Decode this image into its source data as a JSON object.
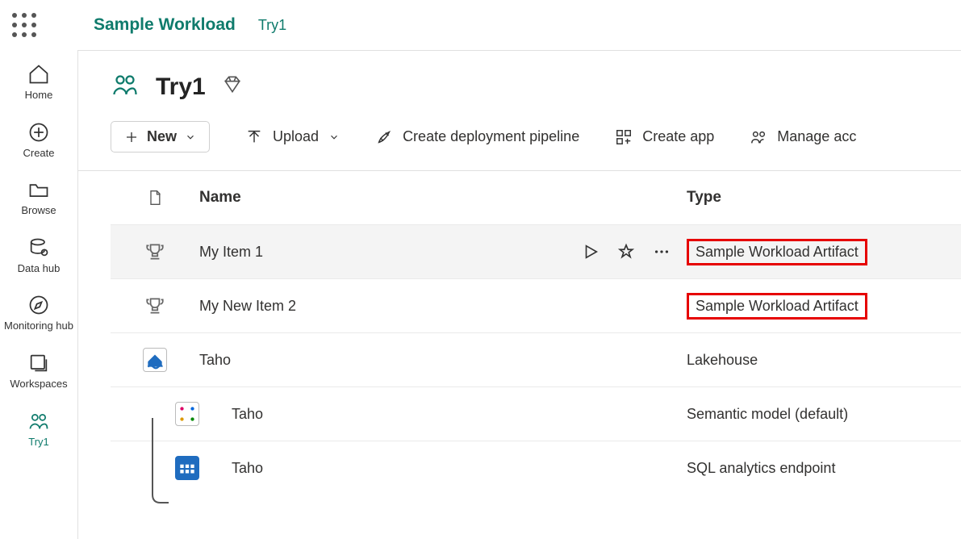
{
  "header": {
    "product": "Sample Workload",
    "workspace": "Try1"
  },
  "nav": {
    "home": "Home",
    "create": "Create",
    "browse": "Browse",
    "datahub": "Data hub",
    "monitoring": "Monitoring hub",
    "workspaces": "Workspaces",
    "current": "Try1"
  },
  "workspace": {
    "name": "Try1"
  },
  "toolbar": {
    "new": "New",
    "upload": "Upload",
    "deploy": "Create deployment pipeline",
    "createapp": "Create app",
    "manage": "Manage acc"
  },
  "columns": {
    "name": "Name",
    "type": "Type"
  },
  "items": [
    {
      "name": "My Item 1",
      "type": "Sample Workload Artifact",
      "highlighted": true,
      "hovered": true
    },
    {
      "name": "My New Item 2",
      "type": "Sample Workload Artifact",
      "highlighted": true
    },
    {
      "name": "Taho",
      "type": "Lakehouse"
    },
    {
      "name": "Taho",
      "type": "Semantic model (default)",
      "child": true
    },
    {
      "name": "Taho",
      "type": "SQL analytics endpoint",
      "child": true
    }
  ]
}
